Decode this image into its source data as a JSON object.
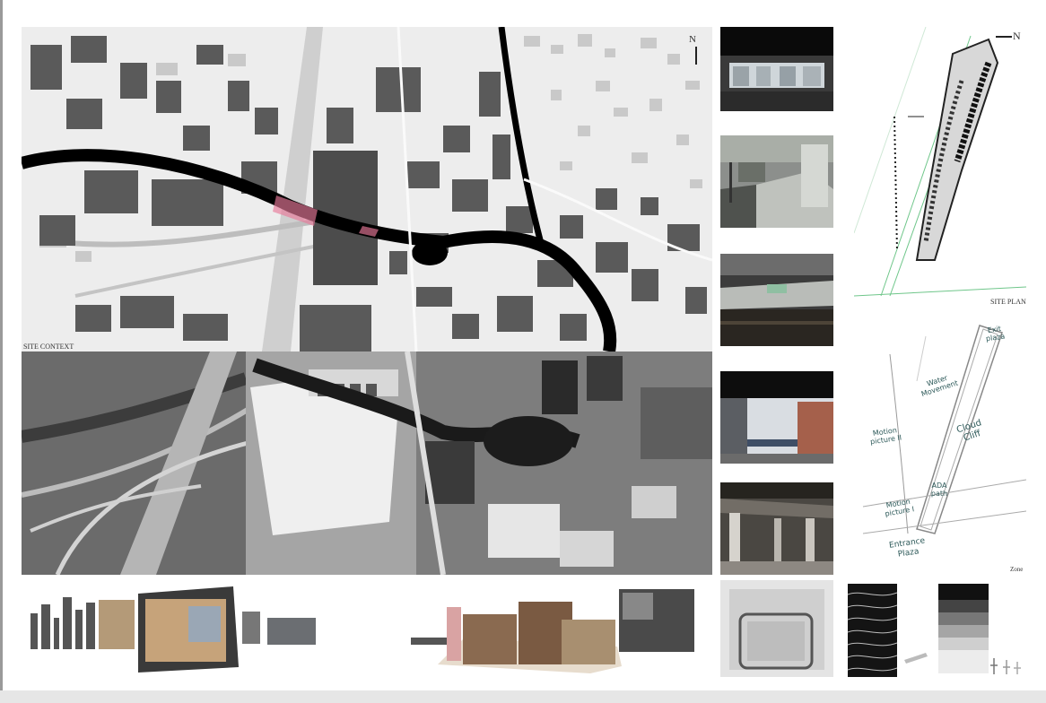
{
  "board": {
    "site_context_label": "SITE CONTEXT",
    "site_plan_label": "SITE PLAN",
    "zone_label": "Zone",
    "north_label": "N",
    "north_label_plan": "N"
  },
  "zone_notes": {
    "exit_plaza": "Exit plaza",
    "water_movement": "Water Movement",
    "cloud_cliff": "Cloud Cliff",
    "motion_picture_2": "Motion picture II",
    "ada_path": "ADA path",
    "motion_picture_1": "Motion picture I",
    "entrance_plaza": "Entrance Plaza"
  },
  "colors": {
    "river": "#000000",
    "highlight": "#e87a9a",
    "building": "#5a5a5a",
    "plan_green": "#6fc68a"
  },
  "icons": [
    "north-arrow-icon"
  ]
}
